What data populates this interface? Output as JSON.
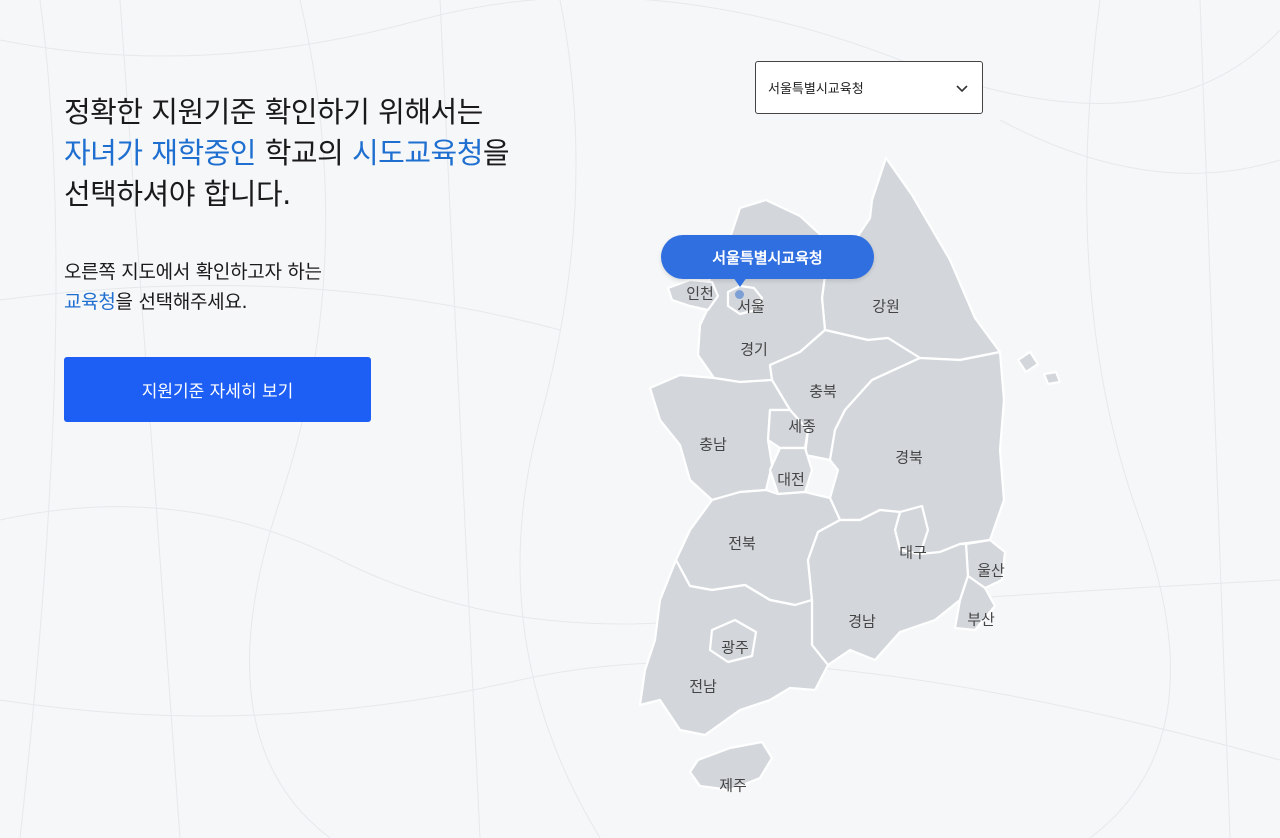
{
  "intro": {
    "line1": "정확한 지원기준 확인하기 위해서는",
    "line2_highlight1": "자녀가 재학중인",
    "line2_mid": " 학교의 ",
    "line2_highlight2": "시도교육청",
    "line2_end": "을",
    "line3": "선택하셔야 합니다."
  },
  "instruction": {
    "line1": "오른쪽 지도에서 확인하고자 하는",
    "highlight": "교육청",
    "line2_end": "을 선택해주세요."
  },
  "cta_label": "지원기준 자세히 보기",
  "select": {
    "value": "서울특별시교육청",
    "icon": "chevron-down-icon"
  },
  "selected_pin_label": "서울특별시교육청",
  "regions": {
    "incheon": "인천",
    "seoul": "서울",
    "gyeonggi": "경기",
    "gangwon": "강원",
    "chungbuk": "충북",
    "chungnam": "충남",
    "sejong": "세종",
    "daejeon": "대전",
    "gyeongbuk": "경북",
    "jeonbuk": "전북",
    "daegu": "대구",
    "ulsan": "울산",
    "gyeongnam": "경남",
    "busan": "부산",
    "gwangju": "광주",
    "jeonnam": "전남",
    "jeju": "제주"
  },
  "colors": {
    "accent": "#1f6fd1",
    "button": "#1d5ff5",
    "pin": "#2f6fe0",
    "region": "#d3d7dc"
  }
}
